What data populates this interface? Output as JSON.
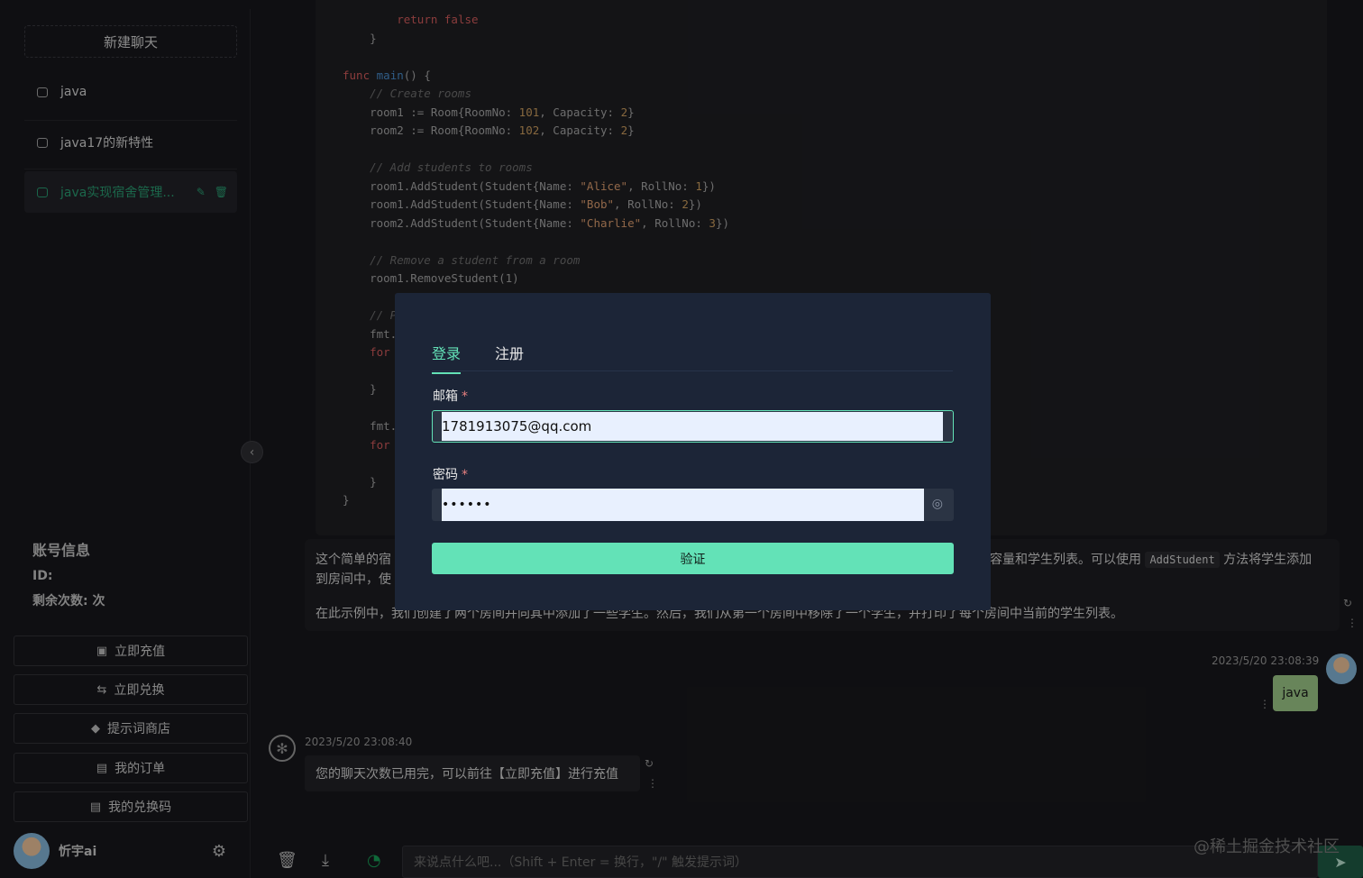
{
  "sidebar": {
    "new_chat": "新建聊天",
    "chats": [
      {
        "label": "java"
      },
      {
        "label": "java17的新特性"
      },
      {
        "label": "java实现宿舍管理..."
      }
    ],
    "account": {
      "title": "账号信息",
      "id_label": "ID:",
      "remaining_label": "剩余次数: 次"
    },
    "buttons": [
      {
        "label": "立即充值",
        "icon": "recharge-icon"
      },
      {
        "label": "立即兑换",
        "icon": "exchange-icon"
      },
      {
        "label": "提示词商店",
        "icon": "store-icon"
      },
      {
        "label": "我的订单",
        "icon": "orders-icon"
      },
      {
        "label": "我的兑换码",
        "icon": "code-icon"
      }
    ],
    "user_name": "忻宇ai"
  },
  "code": {
    "lines": [
      "        return false",
      "    }",
      "",
      "func main() {",
      "    // Create rooms",
      "    room1 := Room{RoomNo: 101, Capacity: 2}",
      "    room2 := Room{RoomNo: 102, Capacity: 2}",
      "",
      "    // Add students to rooms",
      "    room1.AddStudent(Student{Name: \"Alice\", RollNo: 1})",
      "    room1.AddStudent(Student{Name: \"Bob\", RollNo: 2})",
      "    room2.AddStudent(Student{Name: \"Charlie\", RollNo: 3})",
      "",
      "    // Remove a student from a room",
      "    room1.RemoveStudent(1)",
      "",
      "    // P",
      "    fmt.",
      "    for",
      "",
      "    }",
      "",
      "    fmt.",
      "    for",
      "",
      "    }",
      "}"
    ]
  },
  "message": {
    "para1_left": "这个简单的宿",
    "para1_right": "容量和学生列表。可以使用",
    "inline_code": "AddStudent",
    "para1_tail": "方法将学生添加",
    "para2": "到房间中，使",
    "para3": "在此示例中，我们创建了两个房间并向其中添加了一些学生。然后，我们从第一个房间中移除了一个学生，并打印了每个房间中当前的学生列表。"
  },
  "user_msg": {
    "time": "2023/5/20 23:08:39",
    "text": "java"
  },
  "ai_msg": {
    "time": "2023/5/20 23:08:40",
    "text": "您的聊天次数已用完，可以前往【立即充值】进行充值"
  },
  "input": {
    "placeholder": "来说点什么吧...（Shift + Enter = 换行，\"/\" 触发提示词）"
  },
  "watermark": "@稀土掘金技术社区",
  "modal": {
    "tabs": [
      "登录",
      "注册"
    ],
    "email_label": "邮箱",
    "email_value": "1781913075@qq.com",
    "password_label": "密码",
    "password_value": "••••••",
    "required_mark": "*",
    "submit": "验证"
  }
}
